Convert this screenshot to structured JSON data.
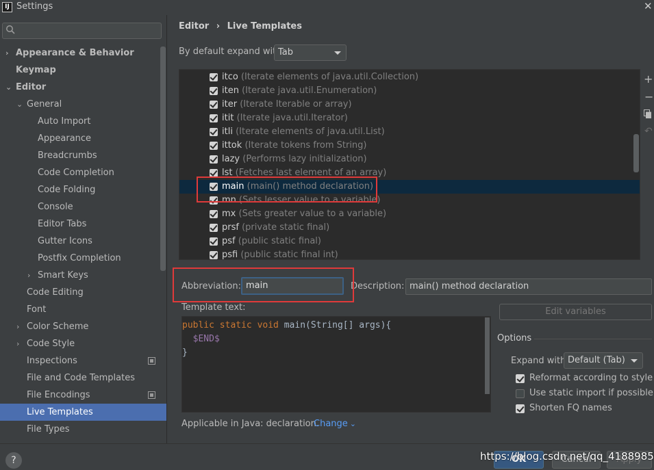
{
  "window": {
    "title": "Settings",
    "icon_text": "IJ"
  },
  "search": {
    "placeholder": "Q-"
  },
  "tree": [
    {
      "label": "Appearance & Behavior",
      "bold": true,
      "indent": 0,
      "arrow": "›"
    },
    {
      "label": "Keymap",
      "bold": true,
      "indent": 0,
      "arrow": ""
    },
    {
      "label": "Editor",
      "bold": true,
      "indent": 0,
      "arrow": "⌄"
    },
    {
      "label": "General",
      "bold": false,
      "indent": 1,
      "arrow": "⌄"
    },
    {
      "label": "Auto Import",
      "bold": false,
      "indent": 2,
      "arrow": ""
    },
    {
      "label": "Appearance",
      "bold": false,
      "indent": 2,
      "arrow": ""
    },
    {
      "label": "Breadcrumbs",
      "bold": false,
      "indent": 2,
      "arrow": ""
    },
    {
      "label": "Code Completion",
      "bold": false,
      "indent": 2,
      "arrow": ""
    },
    {
      "label": "Code Folding",
      "bold": false,
      "indent": 2,
      "arrow": ""
    },
    {
      "label": "Console",
      "bold": false,
      "indent": 2,
      "arrow": ""
    },
    {
      "label": "Editor Tabs",
      "bold": false,
      "indent": 2,
      "arrow": ""
    },
    {
      "label": "Gutter Icons",
      "bold": false,
      "indent": 2,
      "arrow": ""
    },
    {
      "label": "Postfix Completion",
      "bold": false,
      "indent": 2,
      "arrow": ""
    },
    {
      "label": "Smart Keys",
      "bold": false,
      "indent": 2,
      "arrow": "›"
    },
    {
      "label": "Code Editing",
      "bold": false,
      "indent": 1,
      "arrow": ""
    },
    {
      "label": "Font",
      "bold": false,
      "indent": 1,
      "arrow": ""
    },
    {
      "label": "Color Scheme",
      "bold": false,
      "indent": 1,
      "arrow": "›"
    },
    {
      "label": "Code Style",
      "bold": false,
      "indent": 1,
      "arrow": "›"
    },
    {
      "label": "Inspections",
      "bold": false,
      "indent": 1,
      "arrow": "",
      "copy": true
    },
    {
      "label": "File and Code Templates",
      "bold": false,
      "indent": 1,
      "arrow": ""
    },
    {
      "label": "File Encodings",
      "bold": false,
      "indent": 1,
      "arrow": "",
      "copy": true
    },
    {
      "label": "Live Templates",
      "bold": false,
      "indent": 1,
      "arrow": "",
      "selected": true
    },
    {
      "label": "File Types",
      "bold": false,
      "indent": 1,
      "arrow": ""
    }
  ],
  "breadcrumb": {
    "parent": "Editor",
    "separator": "›",
    "current": "Live Templates"
  },
  "default_expand": {
    "label": "By default expand with",
    "value": "Tab"
  },
  "templates": [
    {
      "abbr": "itco",
      "desc": "(Iterate elements of java.util.Collection)"
    },
    {
      "abbr": "iten",
      "desc": "(Iterate java.util.Enumeration)"
    },
    {
      "abbr": "iter",
      "desc": "(Iterate Iterable or array)"
    },
    {
      "abbr": "itit",
      "desc": "(Iterate java.util.Iterator)"
    },
    {
      "abbr": "itli",
      "desc": "(Iterate elements of java.util.List)"
    },
    {
      "abbr": "ittok",
      "desc": "(Iterate tokens from String)"
    },
    {
      "abbr": "lazy",
      "desc": "(Performs lazy initialization)"
    },
    {
      "abbr": "lst",
      "desc": "(Fetches last element of an array)"
    },
    {
      "abbr": "main",
      "desc": "(main() method declaration)",
      "selected": true
    },
    {
      "abbr": "mn",
      "desc": "(Sets lesser value to a variable)"
    },
    {
      "abbr": "mx",
      "desc": "(Sets greater value to a variable)"
    },
    {
      "abbr": "prsf",
      "desc": "(private static final)"
    },
    {
      "abbr": "psf",
      "desc": "(public static final)"
    },
    {
      "abbr": "psfi",
      "desc": "(public static final int)"
    }
  ],
  "details": {
    "abbreviation_label": "Abbreviation:",
    "abbreviation_value": "main",
    "description_label": "Description:",
    "description_value": "main() method declaration",
    "template_text_label": "Template text:",
    "code": {
      "line1_kw": "public static void ",
      "line1_rest": "main(String[] args){",
      "line2": "$END$",
      "line3": "}"
    },
    "edit_variables": "Edit variables",
    "applicable": "Applicable in Java: declaration.",
    "change": "Change"
  },
  "options": {
    "title": "Options",
    "expand_with_label": "Expand with",
    "expand_with_value": "Default (Tab)",
    "reformat": {
      "label": "Reformat according to style",
      "checked": true
    },
    "static_import": {
      "label": "Use static import if possible",
      "checked": false
    },
    "shorten_fq": {
      "label": "Shorten FQ names",
      "checked": true
    }
  },
  "buttons": {
    "ok": "OK",
    "cancel": "Cancel",
    "apply": "Apply",
    "help": "?"
  },
  "watermark": "https://blog.csdn.net/qq_41889856",
  "colors": {
    "accent": "#4b6eaf",
    "highlight": "#e03a3a",
    "link": "#589df6"
  }
}
